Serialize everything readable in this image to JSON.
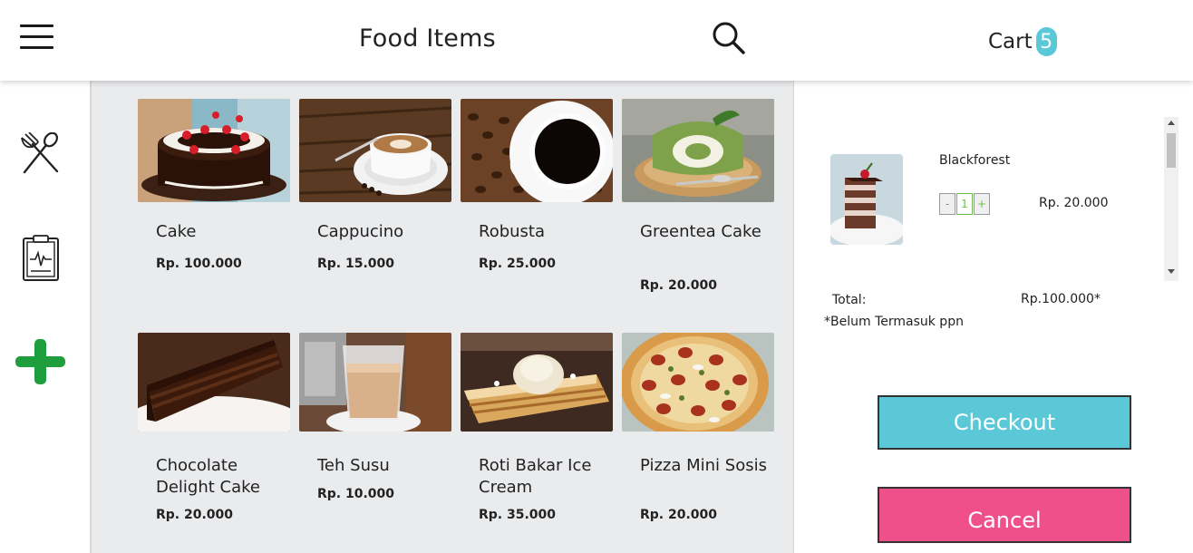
{
  "header": {
    "menu_icon": "hamburger-icon",
    "title": "Food Items",
    "search_icon": "search-icon",
    "cart_label": "Cart",
    "cart_count": "5"
  },
  "sidebar": {
    "items": [
      {
        "icon": "fork-spoon-icon"
      },
      {
        "icon": "clipboard-chart-icon"
      },
      {
        "icon": "plus-icon",
        "color": "#1f9e3e"
      }
    ]
  },
  "products": [
    {
      "name": "Cake",
      "price": "Rp. 100.000",
      "photo": "black-forest-cake"
    },
    {
      "name": "Cappucino",
      "price": "Rp. 15.000",
      "photo": "cappuccino-cup"
    },
    {
      "name": "Robusta",
      "price": "Rp. 25.000",
      "photo": "black-coffee-beans"
    },
    {
      "name": "Greentea Cake",
      "price": "Rp. 20.000",
      "photo": "green-tea-roll-cake"
    },
    {
      "name": "Chocolate Delight Cake",
      "price": "Rp. 20.000",
      "photo": "chocolate-cake-slice"
    },
    {
      "name": "Teh Susu",
      "price": "Rp. 10.000",
      "photo": "milk-tea-glass"
    },
    {
      "name": "Roti Bakar Ice Cream",
      "price": "Rp. 35.000",
      "photo": "toast-ice-cream"
    },
    {
      "name": "Pizza Mini Sosis",
      "price": "Rp. 20.000",
      "photo": "sausage-pizza"
    }
  ],
  "cart_panel": {
    "item": {
      "name": "Blackforest",
      "qty_minus": "-",
      "qty_value": "1",
      "qty_plus": "+",
      "price": "Rp. 20.000",
      "photo": "blackforest-slice"
    },
    "total_label": "Total:",
    "total_value": "Rp.100.000*",
    "note": "*Belum Termasuk ppn",
    "checkout_label": "Checkout",
    "cancel_label": "Cancel"
  },
  "colors": {
    "accent": "#5bc8d8",
    "cancel": "#f0508a",
    "add": "#1f9e3e",
    "qty_green": "#6cc04a",
    "grid_bg": "#eaebed"
  }
}
